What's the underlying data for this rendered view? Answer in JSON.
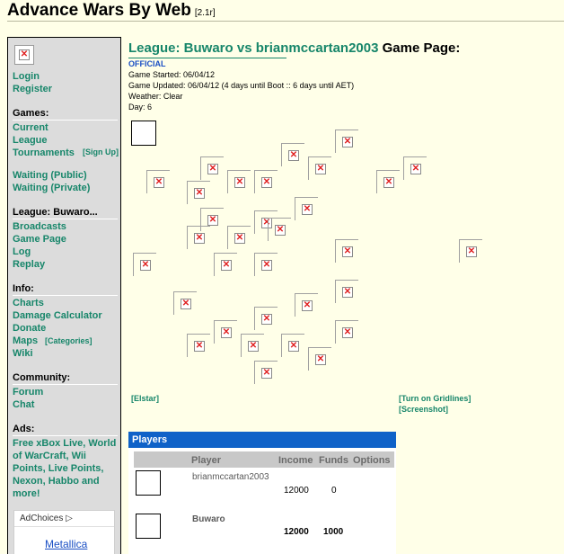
{
  "header": {
    "title": "Advance Wars By Web",
    "version": "[2.1r]"
  },
  "sidebar": {
    "login": "Login",
    "register": "Register",
    "games_head": "Games:",
    "current": "Current",
    "league": "League",
    "tournaments": "Tournaments",
    "signup": "[Sign Up]",
    "waiting_public": "Waiting (Public)",
    "waiting_private": "Waiting (Private)",
    "game_head": "League: Buwaro...",
    "broadcasts": "Broadcasts",
    "game_page": "Game Page",
    "log": "Log",
    "replay": "Replay",
    "info_head": "Info:",
    "charts": "Charts",
    "damage_calc": "Damage Calculator",
    "donate": "Donate",
    "maps": "Maps",
    "categories": "[Categories]",
    "wiki": "Wiki",
    "community_head": "Community:",
    "forum": "Forum",
    "chat": "Chat",
    "ads_head": "Ads:",
    "ad_text": [
      "Free xBox Live, World",
      "of WarCraft, Wii",
      "Points, Live Points,",
      "Nexon, Habbo and",
      "more!"
    ],
    "adchoices": "AdChoices",
    "ad_link": "Metallica"
  },
  "game": {
    "title_link": "League: Buwaro vs brianmccartan2003",
    "title_rest": "Game Page:",
    "official": "OFFICIAL",
    "started": "Game Started: 06/04/12",
    "updated": "Game Updated: 06/04/12 (4 days until Boot :: 6 days until AET)",
    "weather": "Weather: Clear",
    "day": "Day: 6"
  },
  "map": {
    "elstar": "[Elstar]",
    "gridlines": "[Turn on Gridlines]",
    "screenshot": "[Screenshot]"
  },
  "players": {
    "title": "Players",
    "columns": [
      "Player",
      "Income",
      "Funds",
      "Options"
    ],
    "rows": [
      {
        "name": "brianmccartan2003",
        "income": "12000",
        "funds": "0"
      },
      {
        "name": "Buwaro",
        "income": "12000",
        "funds": "1000"
      }
    ]
  }
}
